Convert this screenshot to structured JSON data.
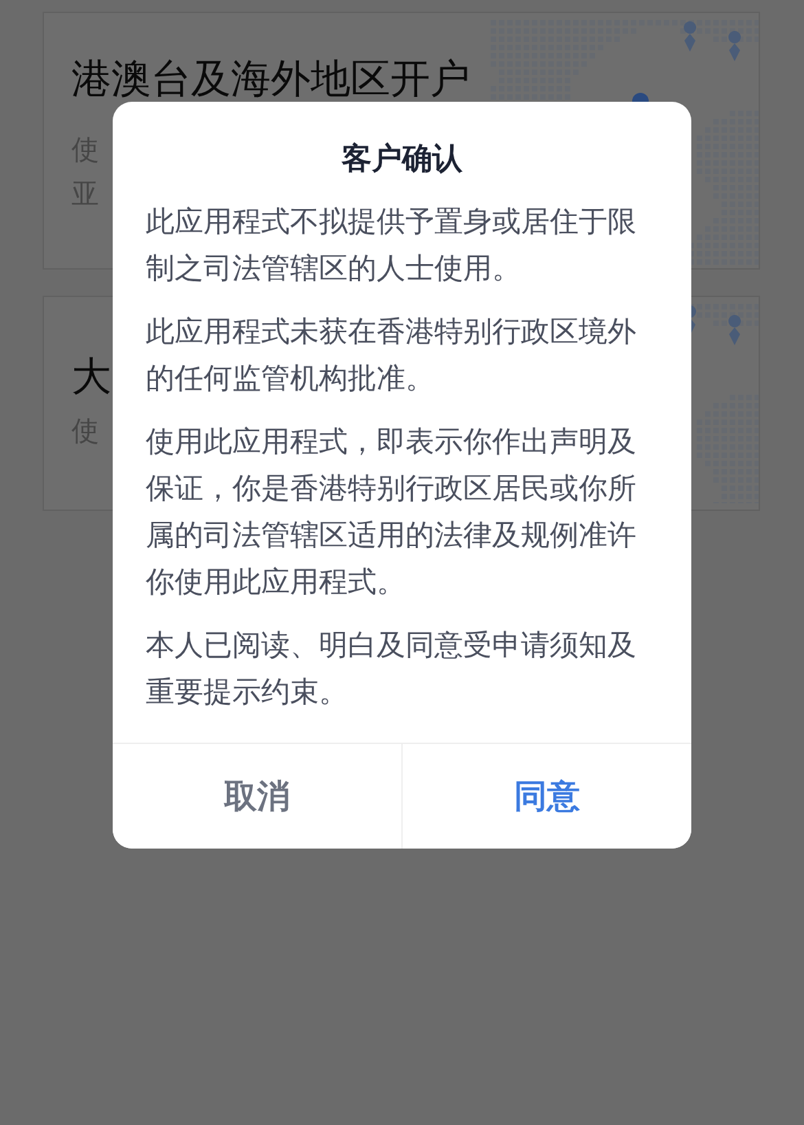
{
  "background_cards": [
    {
      "title": "港澳台及海外地区开户",
      "lines": [
        "使",
        "亚"
      ]
    },
    {
      "title": "大",
      "lines": [
        "使"
      ]
    }
  ],
  "dialog": {
    "title": "客户确认",
    "paragraphs": [
      "此应用程式不拟提供予置身或居住于限制之司法管辖区的人士使用。",
      "此应用程式未获在香港特别行政区境外的任何监管机构批准。",
      "使用此应用程式，即表示你作出声明及保证，你是香港特别行政区居民或你所属的司法管辖区适用的法律及规例准许你使用此应用程式。",
      "本人已阅读、明白及同意受申请须知及重要提示约束。"
    ],
    "buttons": [
      {
        "label": "取消",
        "kind": "cancel"
      },
      {
        "label": "同意",
        "kind": "confirm"
      }
    ]
  }
}
